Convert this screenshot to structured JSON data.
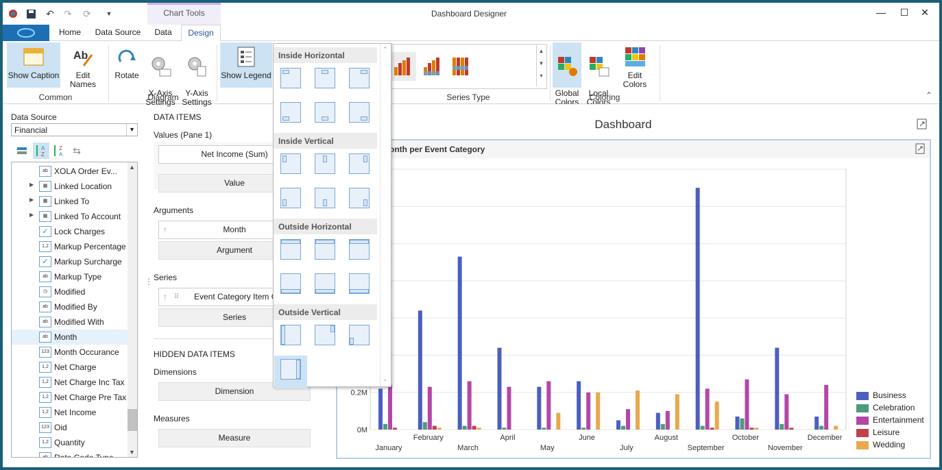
{
  "window": {
    "title": "Dashboard Designer",
    "context_tab": "Chart Tools",
    "controls": [
      "—",
      "☐",
      "✕"
    ]
  },
  "tabs": [
    "Home",
    "Data Source",
    "Data",
    "Design"
  ],
  "ribbon": {
    "common": {
      "label": "Common",
      "show_caption": "Show Caption",
      "edit_names": "Edit Names"
    },
    "diagram": {
      "label": "Diagram",
      "rotate": "Rotate",
      "x_axis": "X-Axis\nSettings",
      "y_axis": "Y-Axis\nSettings"
    },
    "show_legend": "Show Legend",
    "series_type": {
      "label": "Series Type"
    },
    "coloring": {
      "label": "Coloring",
      "global": "Global\nColors",
      "local": "Local\nColors",
      "edit": "Edit Colors"
    }
  },
  "data_source": {
    "label": "Data Source",
    "value": "Financial",
    "fields": [
      {
        "name": "XOLA Order Ev...",
        "type": "ab",
        "expand": false
      },
      {
        "name": "Linked Location",
        "type": "table",
        "expand": true
      },
      {
        "name": "Linked To",
        "type": "table",
        "expand": true
      },
      {
        "name": "Linked To Account",
        "type": "table",
        "expand": true
      },
      {
        "name": "Lock Charges",
        "type": "check",
        "expand": false
      },
      {
        "name": "Markup Percentage",
        "type": "1,2",
        "expand": false
      },
      {
        "name": "Markup Surcharge",
        "type": "check",
        "expand": false
      },
      {
        "name": "Markup Type",
        "type": "ab",
        "expand": false
      },
      {
        "name": "Modified",
        "type": "clock",
        "expand": false
      },
      {
        "name": "Modified By",
        "type": "ab",
        "expand": false
      },
      {
        "name": "Modified With",
        "type": "ab",
        "expand": false
      },
      {
        "name": "Month",
        "type": "ab",
        "expand": false,
        "selected": true
      },
      {
        "name": "Month Occurance",
        "type": "123",
        "expand": false
      },
      {
        "name": "Net Charge",
        "type": "1,2",
        "expand": false
      },
      {
        "name": "Net Charge Inc Tax",
        "type": "1,2",
        "expand": false
      },
      {
        "name": "Net Charge Pre Tax",
        "type": "1,2",
        "expand": false
      },
      {
        "name": "Net Income",
        "type": "1,2",
        "expand": false
      },
      {
        "name": "Oid",
        "type": "123",
        "expand": false
      },
      {
        "name": "Quantity",
        "type": "1,2",
        "expand": false
      },
      {
        "name": "Rate Code Type",
        "type": "ab",
        "expand": false
      }
    ]
  },
  "data_items": {
    "title": "DATA ITEMS",
    "values_label": "Values (Pane 1)",
    "values_item": "Net Income (Sum)",
    "values_placeholder": "Value",
    "arguments_label": "Arguments",
    "arguments_item": "Month",
    "arguments_placeholder": "Argument",
    "series_label": "Series",
    "series_item": "Event Category Item Co",
    "series_placeholder": "Series",
    "hidden_title": "HIDDEN DATA ITEMS",
    "dimensions_label": "Dimensions",
    "dimensions_placeholder": "Dimension",
    "measures_label": "Measures",
    "measures_placeholder": "Measure"
  },
  "legend_dropdown": {
    "groups": [
      "Inside Horizontal",
      "Inside Vertical",
      "Outside Horizontal",
      "Outside Vertical"
    ]
  },
  "dashboard": {
    "title": "Dashboard",
    "chart_title": "onth per Event Category"
  },
  "chart_data": {
    "type": "bar",
    "title": "onth per Event Category",
    "categories": [
      "January",
      "February",
      "March",
      "April",
      "May",
      "June",
      "July",
      "August",
      "September",
      "October",
      "November",
      "December"
    ],
    "ytick_labels": [
      "0M",
      "0.2M"
    ],
    "ylim": [
      0,
      1.4
    ],
    "legend": "right",
    "series": [
      {
        "name": "Business",
        "color": "#4b5fbf",
        "values": [
          0.22,
          0.64,
          0.93,
          0.44,
          0.23,
          0.26,
          0.05,
          0.09,
          1.3,
          0.07,
          0.44,
          0.07
        ]
      },
      {
        "name": "Celebration",
        "color": "#4f9a7a",
        "values": [
          0.03,
          0.04,
          0.02,
          0.01,
          0.01,
          0.01,
          0.02,
          0.03,
          0.02,
          0.06,
          0.03,
          0.02
        ]
      },
      {
        "name": "Entertainment",
        "color": "#b347a8",
        "values": [
          0.24,
          0.23,
          0.26,
          0.23,
          0.26,
          0.2,
          0.11,
          0.1,
          0.22,
          0.27,
          0.19,
          0.24
        ]
      },
      {
        "name": "Leisure",
        "color": "#c0404b",
        "values": [
          0.01,
          0.02,
          0.02,
          0.0,
          0.0,
          0.0,
          0.0,
          0.0,
          0.01,
          0.01,
          0.01,
          0.0
        ]
      },
      {
        "name": "Wedding",
        "color": "#e8a84e",
        "values": [
          0.0,
          0.01,
          0.01,
          0.0,
          0.09,
          0.2,
          0.21,
          0.19,
          0.15,
          0.01,
          0.0,
          0.02
        ]
      }
    ]
  }
}
